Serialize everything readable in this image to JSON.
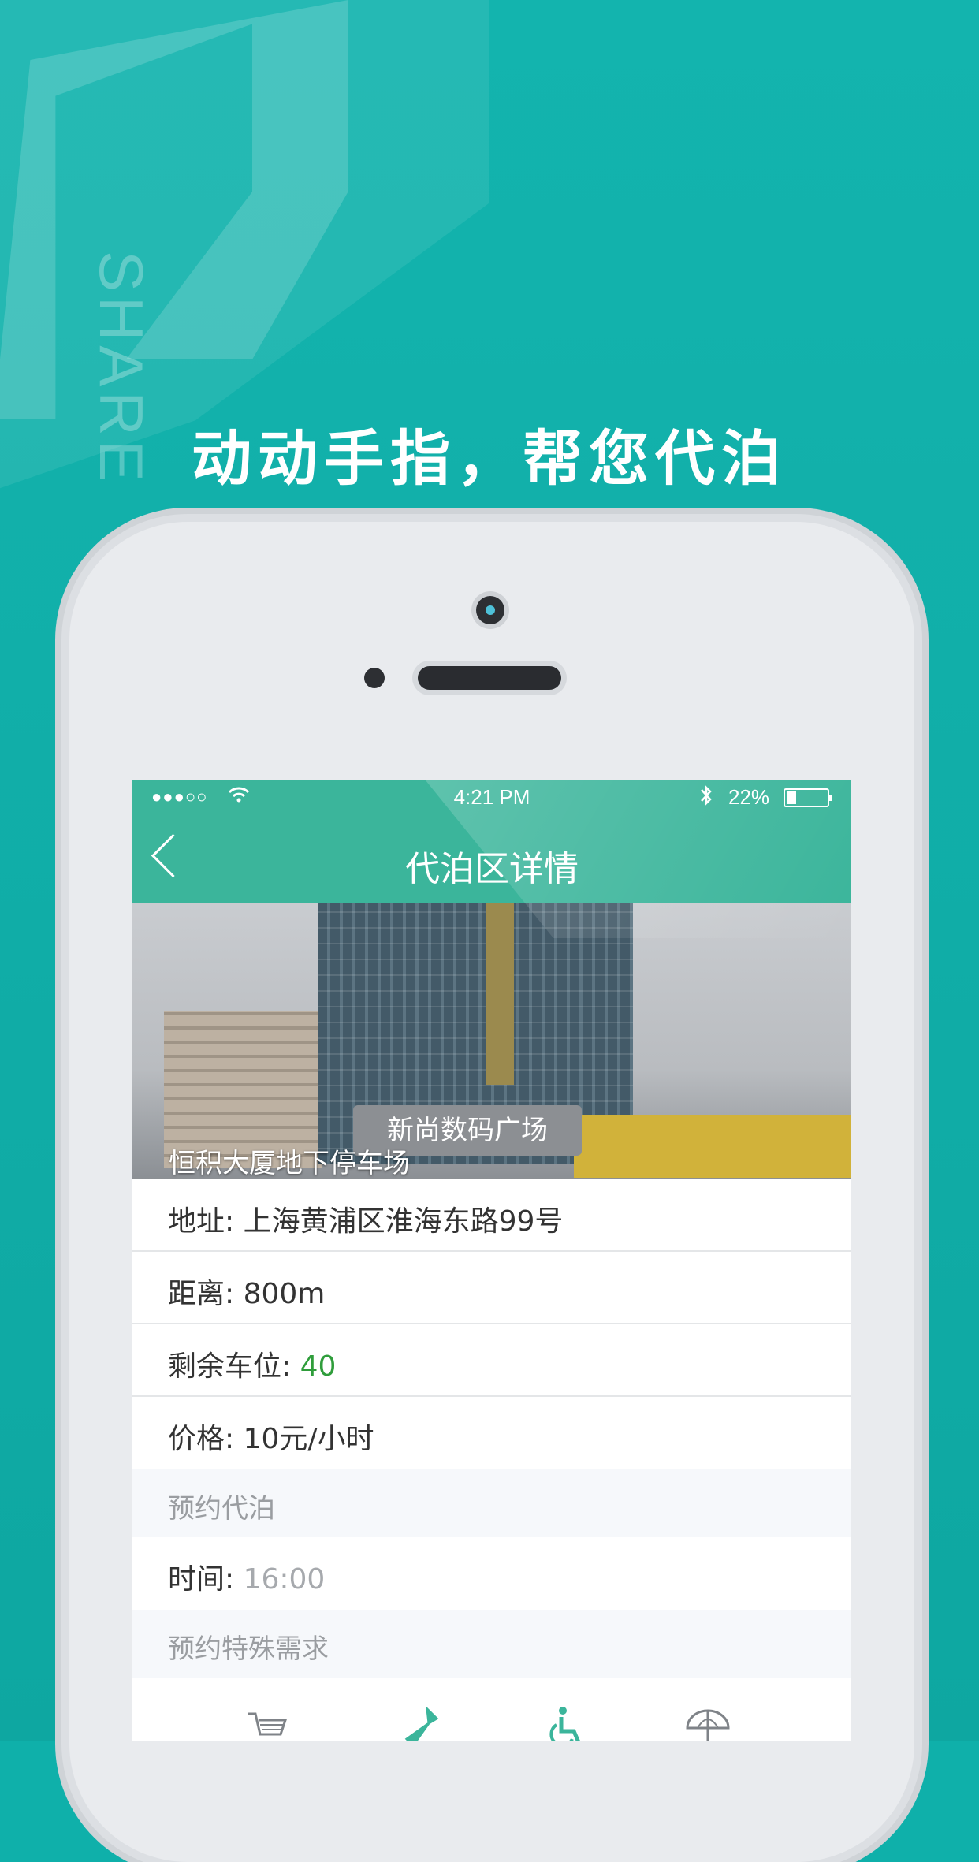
{
  "promo": {
    "watermark": "SHARE",
    "headline": "动动手指，帮您代泊"
  },
  "status_bar": {
    "signal": "●●●○○",
    "time": "4:21 PM",
    "battery_percent": "22%",
    "battery_level": 0.22
  },
  "nav": {
    "title": "代泊区详情"
  },
  "hero": {
    "sign_text": "新尚数码广场",
    "caption": "恒积大厦地下停车场"
  },
  "details": {
    "address_label": "地址:",
    "address_value": "上海黄浦区淮海东路99号",
    "distance_label": "距离:",
    "distance_value": "800m",
    "spaces_label": "剩余车位:",
    "spaces_value": "40",
    "price_label": "价格:",
    "price_value": "10元/小时"
  },
  "booking": {
    "section_title": "预约代泊",
    "time_label": "时间:",
    "time_value": "16:00",
    "special_title": "预约特殊需求"
  },
  "service_icons": [
    "shopping-cart-icon",
    "flashlight-icon",
    "wheelchair-icon",
    "umbrella-icon"
  ],
  "colors": {
    "background": "#0fb0aa",
    "header": "#3bb59b",
    "accent_green": "#2f9d3b"
  }
}
